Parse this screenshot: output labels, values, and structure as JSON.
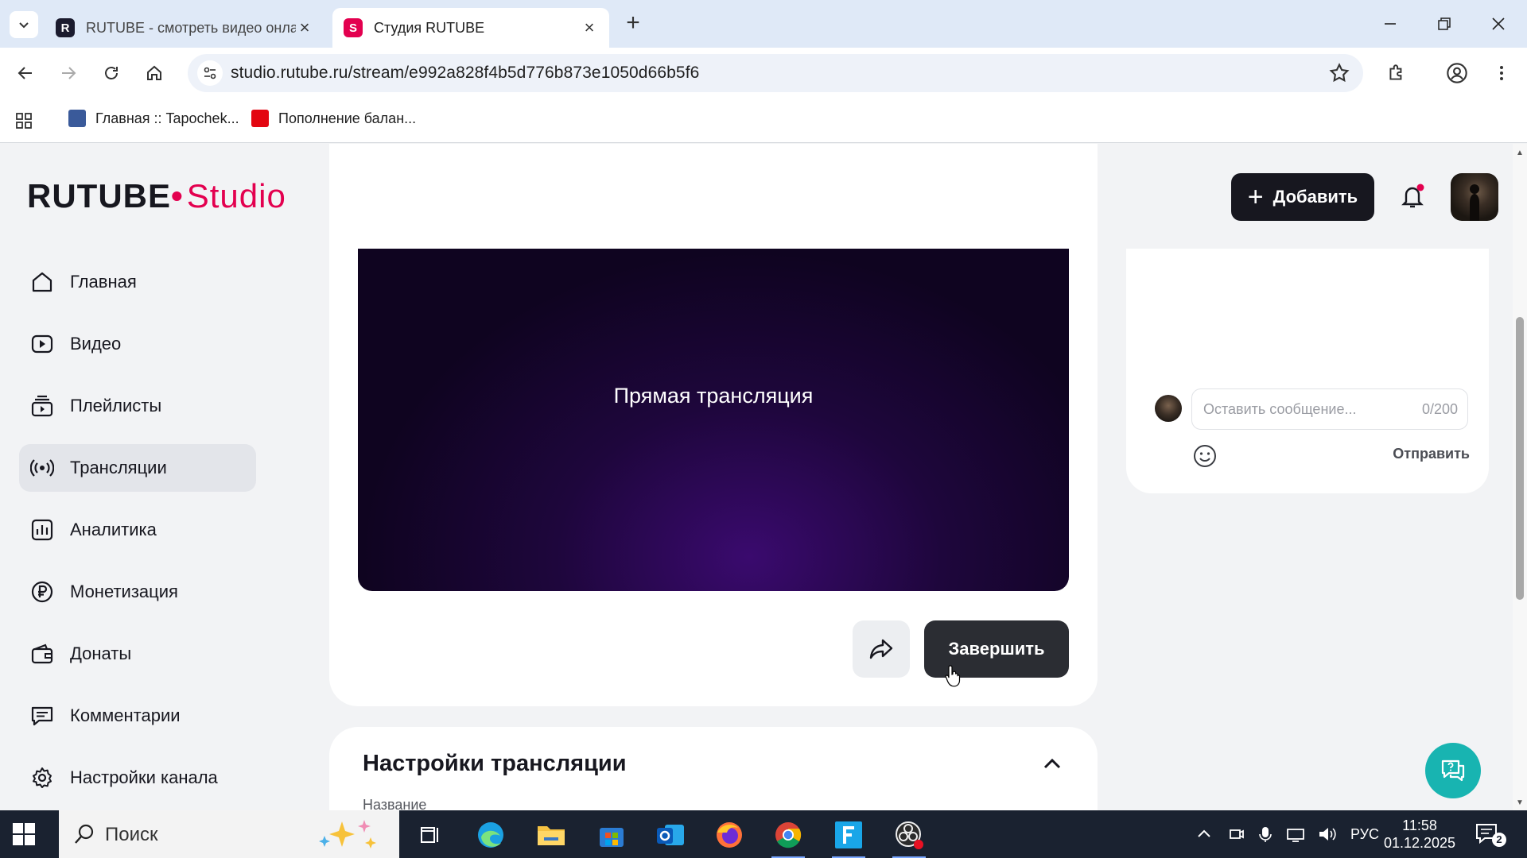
{
  "browser": {
    "tabs": [
      {
        "title": "RUTUBE - смотреть видео онлайн",
        "favicon": "R",
        "active": false
      },
      {
        "title": "Студия RUTUBE",
        "favicon": "S",
        "active": true
      }
    ],
    "url": "studio.rutube.ru/stream/e992a828f4b5d776b873e1050d66b5f6",
    "bookmarks": [
      {
        "label": "Главная :: Tapochek..."
      },
      {
        "label": "Пополнение балан..."
      }
    ]
  },
  "header": {
    "logo_main": "RUTUBE",
    "logo_dot": "•",
    "logo_sub": "Studio",
    "add_button": "Добавить"
  },
  "sidebar": {
    "items": [
      {
        "label": "Главная",
        "icon": "home-icon",
        "active": false
      },
      {
        "label": "Видео",
        "icon": "video-icon",
        "active": false
      },
      {
        "label": "Плейлисты",
        "icon": "playlists-icon",
        "active": false
      },
      {
        "label": "Трансляции",
        "icon": "broadcast-icon",
        "active": true
      },
      {
        "label": "Аналитика",
        "icon": "analytics-icon",
        "active": false
      },
      {
        "label": "Монетизация",
        "icon": "ruble-icon",
        "active": false
      },
      {
        "label": "Донаты",
        "icon": "wallet-icon",
        "active": false
      },
      {
        "label": "Комментарии",
        "icon": "comments-icon",
        "active": false
      },
      {
        "label": "Настройки канала",
        "icon": "gear-icon",
        "active": false
      }
    ]
  },
  "player": {
    "title": "Прямая трансляция",
    "end_button": "Завершить"
  },
  "settings": {
    "title": "Настройки трансляции",
    "field_label": "Название"
  },
  "chat": {
    "placeholder": "Оставить сообщение...",
    "counter": "0/200",
    "send": "Отправить"
  },
  "taskbar": {
    "search": "Поиск",
    "language": "РУС",
    "time": "11:58",
    "date": "01.12.2025",
    "notifications": "2"
  },
  "colors": {
    "accent": "#e3004f",
    "dark": "#17171f",
    "support": "#18b4b1"
  }
}
